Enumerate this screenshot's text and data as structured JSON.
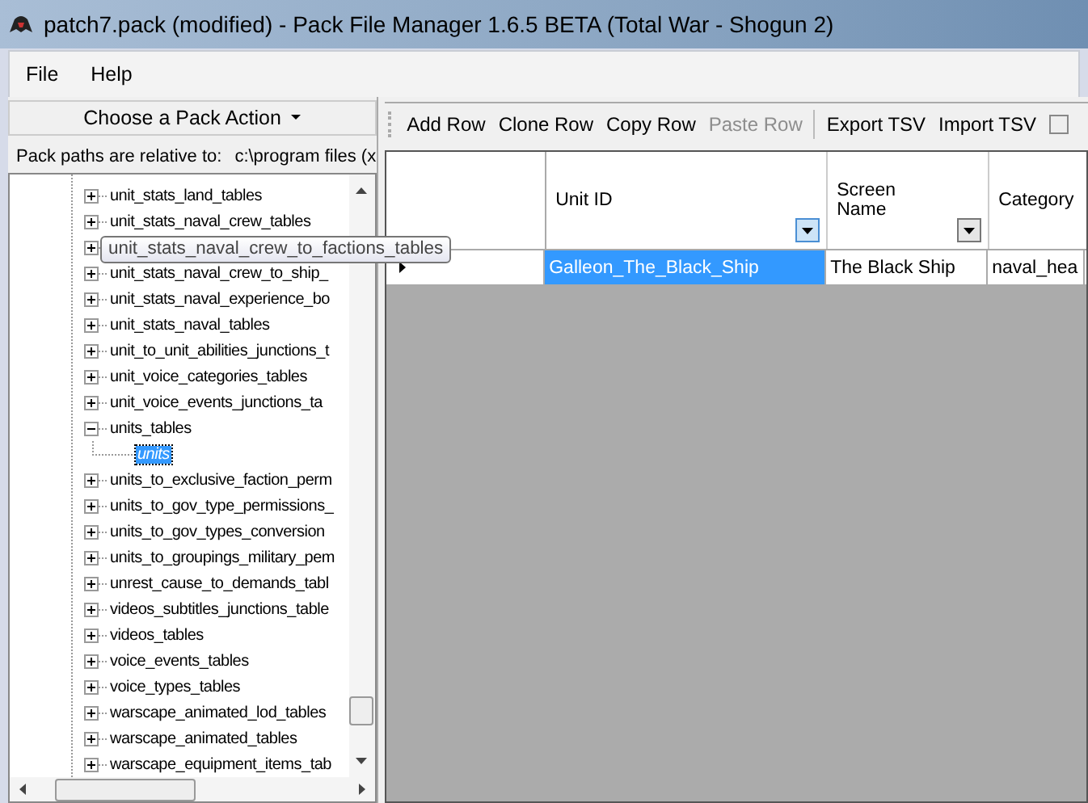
{
  "window": {
    "title": "patch7.pack (modified) - Pack File Manager 1.6.5 BETA (Total War - Shogun 2)"
  },
  "menu": [
    "File",
    "Help"
  ],
  "pack_action": {
    "label": "Choose a Pack Action"
  },
  "pack_paths": {
    "label": "Pack paths are relative to:",
    "value": "c:\\program files (x"
  },
  "tree": [
    {
      "label": "unit_stats_land_tables",
      "expanded": false
    },
    {
      "label": "unit_stats_naval_crew_tables",
      "expanded": false
    },
    {
      "expanded": false
    },
    {
      "label": "unit_stats_naval_crew_to_ship_",
      "expanded": false
    },
    {
      "label": "unit_stats_naval_experience_bo",
      "expanded": false
    },
    {
      "label": "unit_stats_naval_tables",
      "expanded": false
    },
    {
      "label": "unit_to_unit_abilities_junctions_t",
      "expanded": false
    },
    {
      "label": "unit_voice_categories_tables",
      "expanded": false
    },
    {
      "label": "unit_voice_events_junctions_ta",
      "expanded": false
    },
    {
      "label": "units_tables",
      "expanded": true,
      "children": [
        {
          "label": "units",
          "selected": true
        }
      ]
    },
    {
      "label": "units_to_exclusive_faction_perm",
      "expanded": false
    },
    {
      "label": "units_to_gov_type_permissions_",
      "expanded": false
    },
    {
      "label": "units_to_gov_types_conversion",
      "expanded": false
    },
    {
      "label": "units_to_groupings_military_pem",
      "expanded": false
    },
    {
      "label": "unrest_cause_to_demands_tabl",
      "expanded": false
    },
    {
      "label": "videos_subtitles_junctions_table",
      "expanded": false
    },
    {
      "label": "videos_tables",
      "expanded": false
    },
    {
      "label": "voice_events_tables",
      "expanded": false
    },
    {
      "label": "voice_types_tables",
      "expanded": false
    },
    {
      "label": "warscape_animated_lod_tables",
      "expanded": false
    },
    {
      "label": "warscape_animated_tables",
      "expanded": false
    },
    {
      "label": "warscape_equipment_items_tab",
      "expanded": false
    }
  ],
  "tooltip": "unit_stats_naval_crew_to_factions_tables",
  "toolbar": [
    {
      "label": "Add Row",
      "disabled": false
    },
    {
      "label": "Clone Row",
      "disabled": false
    },
    {
      "label": "Copy Row",
      "disabled": false
    },
    {
      "label": "Paste Row",
      "disabled": true
    },
    {
      "kind": "separator"
    },
    {
      "label": "Export TSV",
      "disabled": false
    },
    {
      "label": "Import TSV",
      "disabled": false
    }
  ],
  "toolbar_checkbox": {
    "checked": false
  },
  "table": {
    "columns": [
      {
        "label": "Unit ID",
        "filter": true
      },
      {
        "label": "Screen Name",
        "filter": true
      },
      {
        "label": "Category",
        "filter": false
      }
    ],
    "rows": [
      {
        "cells": [
          "Galleon_The_Black_Ship",
          "The Black Ship",
          "naval_hea"
        ],
        "current": true
      }
    ]
  }
}
